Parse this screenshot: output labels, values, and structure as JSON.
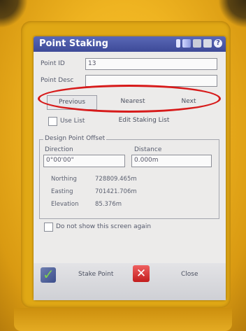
{
  "window": {
    "title": "Point Staking",
    "status_icons": [
      "antenna-icon",
      "signal-icon",
      "radio-icon",
      "battery-icon",
      "help-icon"
    ],
    "help_glyph": "?"
  },
  "form": {
    "point_id_label": "Point ID",
    "point_id_value": "13",
    "point_desc_label": "Point Desc",
    "point_desc_value": ""
  },
  "navigation": {
    "previous_label": "Previous",
    "nearest_label": "Nearest",
    "next_label": "Next",
    "highlight_color": "#d71a1a"
  },
  "list": {
    "use_list_label": "Use List",
    "use_list_checked": false,
    "edit_list_label": "Edit Staking List"
  },
  "offset": {
    "group_title": "Design Point Offset",
    "direction_label": "Direction",
    "direction_value": "0°00'00\"",
    "distance_label": "Distance",
    "distance_value": "0.000m"
  },
  "coordinates": {
    "northing_label": "Northing",
    "northing_value": "728809.465m",
    "easting_label": "Easting",
    "easting_value": "701421.706m",
    "elevation_label": "Elevation",
    "elevation_value": "85.376m"
  },
  "options": {
    "dont_show_label": "Do not show this screen again",
    "dont_show_checked": false
  },
  "actions": {
    "stake_point_label": "Stake Point",
    "close_label": "Close",
    "close_glyph": "✕"
  },
  "colors": {
    "device_body": "#efb421",
    "title_bar": "#3d4a98",
    "screen_bg": "#ecebea"
  }
}
